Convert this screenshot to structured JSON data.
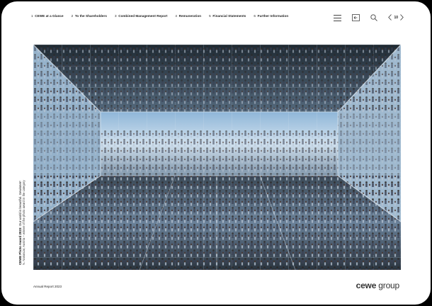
{
  "nav": {
    "items": [
      {
        "num": "1",
        "label": "CEWE at a Glance"
      },
      {
        "num": "2",
        "label": "To the Shareholders"
      },
      {
        "num": "3",
        "label": "Combined Management Report"
      },
      {
        "num": "4",
        "label": "Remuneration"
      },
      {
        "num": "5",
        "label": "Financial Statements"
      },
      {
        "num": "6",
        "label": "Further Information"
      }
    ]
  },
  "toolbar": {
    "menu_icon": "hamburger-menu-icon",
    "back_icon": "back-to-page-icon",
    "search_icon": "search-icon",
    "page_number": "10"
  },
  "photo": {
    "caption_title": "CEWE Photo Award 2023:",
    "caption_subtitle": " Our world is beautiful. Gewinner!",
    "caption_line2": "N. Nanascar, Austria – winner of the photo award in the category"
  },
  "footer": {
    "report": "Annual Report 2023",
    "brand_main": "cewe",
    "brand_sub": " group"
  }
}
